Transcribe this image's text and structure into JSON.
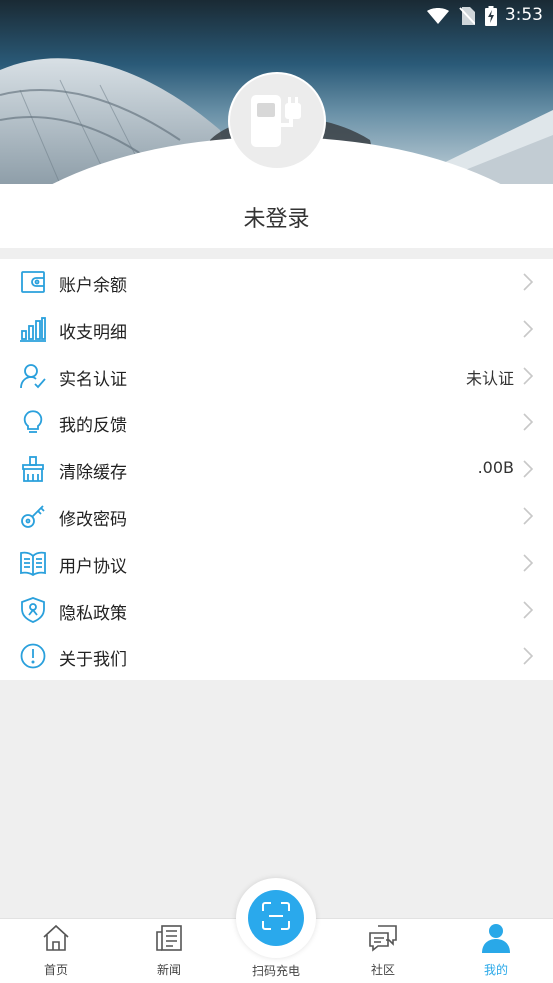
{
  "status": {
    "time": "3:53",
    "icons": [
      "wifi-icon",
      "no-sim-icon",
      "battery-charging-icon"
    ]
  },
  "profile": {
    "login_label": "未登录",
    "avatar_icon": "charging-station-icon"
  },
  "menu": [
    {
      "id": "balance",
      "label": "账户余额",
      "value": "",
      "icon": "wallet-icon"
    },
    {
      "id": "transactions",
      "label": "收支明细",
      "value": "",
      "icon": "bar-chart-icon"
    },
    {
      "id": "verification",
      "label": "实名认证",
      "value": "未认证",
      "icon": "user-check-icon"
    },
    {
      "id": "feedback",
      "label": "我的反馈",
      "value": "",
      "icon": "lightbulb-icon"
    },
    {
      "id": "cache",
      "label": "清除缓存",
      "value": ".00B",
      "icon": "brush-icon"
    },
    {
      "id": "password",
      "label": "修改密码",
      "value": "",
      "icon": "key-icon"
    },
    {
      "id": "agreement",
      "label": "用户协议",
      "value": "",
      "icon": "book-icon"
    },
    {
      "id": "privacy",
      "label": "隐私政策",
      "value": "",
      "icon": "shield-icon"
    },
    {
      "id": "about",
      "label": "关于我们",
      "value": "",
      "icon": "info-icon"
    }
  ],
  "tabs": [
    {
      "id": "home",
      "label": "首页",
      "icon": "home-icon"
    },
    {
      "id": "news",
      "label": "新闻",
      "icon": "news-icon"
    },
    {
      "id": "scan",
      "label": "扫码充电",
      "icon": "scan-icon"
    },
    {
      "id": "community",
      "label": "社区",
      "icon": "chat-icon"
    },
    {
      "id": "mine",
      "label": "我的",
      "icon": "person-icon",
      "active": true
    }
  ],
  "colors": {
    "accent": "#29a8e8",
    "icon_stroke": "#2aa0dc",
    "text": "#222222",
    "background": "#efefef"
  }
}
